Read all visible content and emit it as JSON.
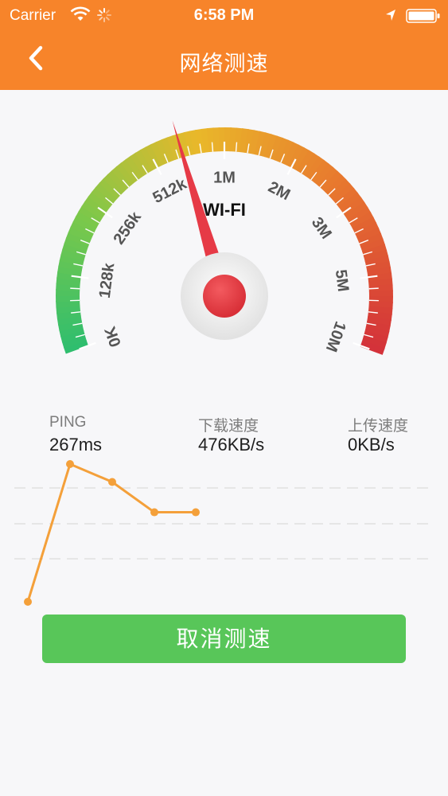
{
  "status_bar": {
    "carrier": "Carrier",
    "time": "6:58 PM",
    "icons": [
      "wifi-icon",
      "activity-spinner-icon",
      "location-arrow-icon",
      "battery-icon"
    ]
  },
  "nav": {
    "title": "网络测速",
    "back_icon": "chevron-left-icon"
  },
  "gauge": {
    "network_label": "WI-FI",
    "tick_labels": [
      "0K",
      "128k",
      "256k",
      "512k",
      "1M",
      "2M",
      "3M",
      "5M",
      "10M"
    ],
    "needle_position_label_index": 3.4,
    "colors": {
      "low": "#2fbe6e",
      "mid": "#e9b82a",
      "high": "#d3303a",
      "needle": "#e63a46"
    }
  },
  "stats": {
    "ping": {
      "label": "PING",
      "value": "267ms"
    },
    "download": {
      "label": "下载速度",
      "value": "476KB/s"
    },
    "upload": {
      "label": "上传速度",
      "value": "0KB/s"
    }
  },
  "chart_data": {
    "type": "line",
    "x": [
      0,
      1,
      2,
      3,
      4
    ],
    "values": [
      0.0,
      1.0,
      0.87,
      0.65,
      0.65
    ],
    "series_color": "#f4a03a",
    "grid": true
  },
  "actions": {
    "cancel_label": "取消测速",
    "cancel_color": "#58c659"
  }
}
